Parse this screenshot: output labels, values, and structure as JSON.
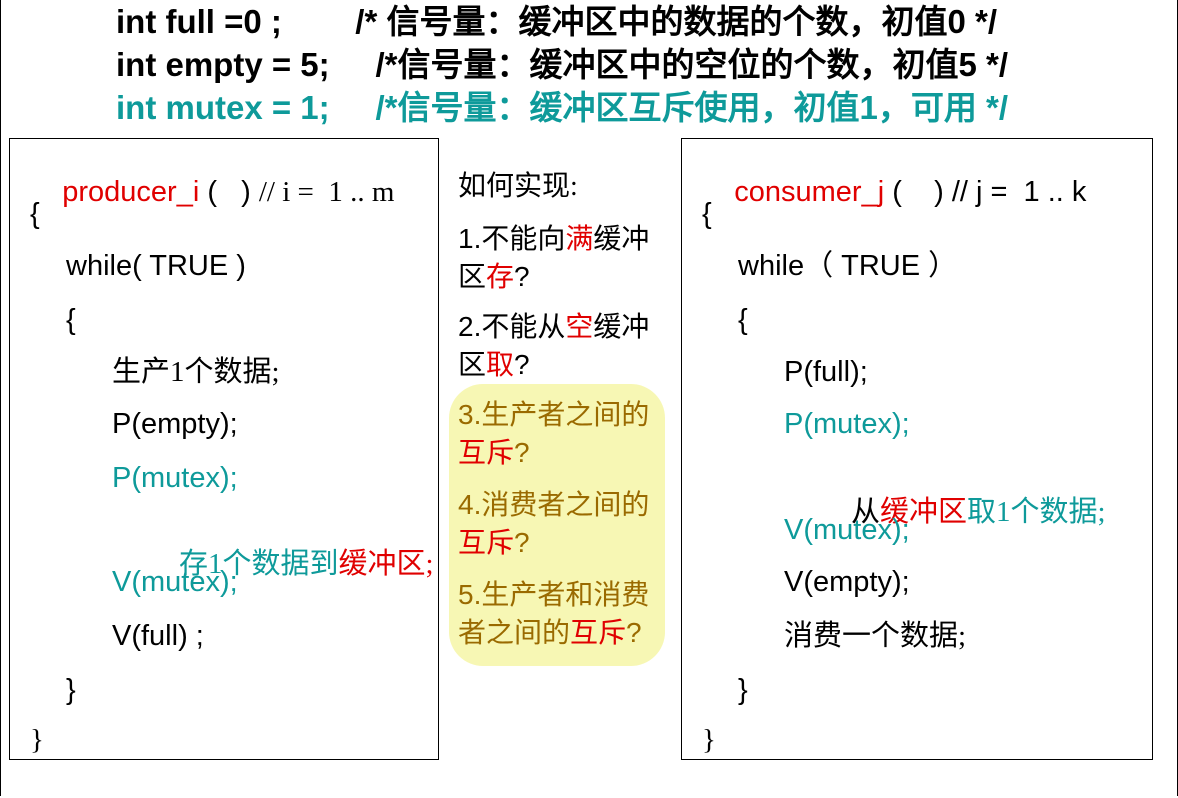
{
  "declarations": [
    {
      "code": "int full =0 ;",
      "comment": "/* 信号量：缓冲区中的数据的个数，初值0 */",
      "highlight": false
    },
    {
      "code": "int empty = 5;",
      "comment": "/*信号量：缓冲区中的空位的个数，初值5 */",
      "highlight": false
    },
    {
      "code": "int mutex = 1;",
      "comment": "/*信号量：缓冲区互斥使用，初值1，可用 */",
      "highlight": true
    }
  ],
  "producer": {
    "name": "producer_i",
    "signature_rest": " (   ) ",
    "comment": "// i =  1 .. m",
    "open_brace": "{",
    "while": "while( TRUE )",
    "inner_open": "{",
    "produce": "生产1个数据;",
    "p_empty": "P(empty);",
    "p_mutex": "P(mutex);",
    "store_prefix": "存1个数据到",
    "store_target": "缓冲区;",
    "v_mutex": "V(mutex);",
    "v_full": "V(full) ;",
    "inner_close": "}",
    "close_brace": "}"
  },
  "consumer": {
    "name": "consumer_j",
    "signature_rest": " (    ) ",
    "comment": "// j =  1 .. k",
    "open_brace": "{",
    "while": "while（ TRUE ）",
    "inner_open": "{",
    "p_full": "P(full);",
    "p_mutex": "P(mutex);",
    "take_prefix": "从",
    "take_target": "缓冲区",
    "take_suffix": "取1个数据;",
    "v_mutex": "V(mutex);",
    "v_empty": "V(empty);",
    "consume": "消费一个数据;",
    "inner_close": "}",
    "close_brace": "}"
  },
  "questions": {
    "title": "如何实现:",
    "q1": {
      "a": "1.不能向",
      "b": "满",
      "c": "缓冲",
      "d": "区",
      "e": "存",
      "f": "?"
    },
    "q2": {
      "a": "2.不能从",
      "b": "空",
      "c": "缓冲",
      "d": "区",
      "e": "取",
      "f": "?"
    },
    "q3": {
      "a": "3.生产者之间的",
      "b": "互斥",
      "c": "?"
    },
    "q4": {
      "a": "4.消费者之间的",
      "b": "互斥",
      "c": "?"
    },
    "q5": {
      "a": "5.生产者和消费",
      "b": "者之间的",
      "c": "互斥",
      "d": "?"
    }
  },
  "colors": {
    "accent_teal": "#0e9a9a",
    "accent_red": "#e00000",
    "highlight_yellow": "#f7f7b4"
  }
}
